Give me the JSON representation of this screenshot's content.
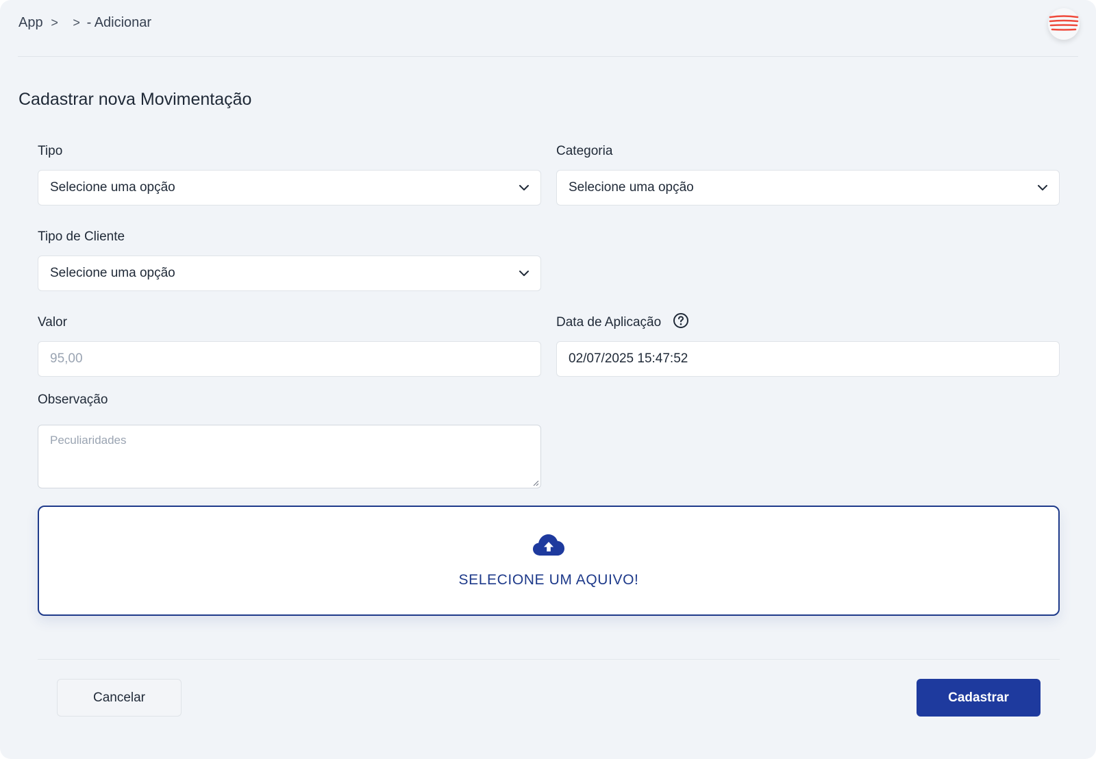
{
  "breadcrumb": {
    "root": "App",
    "separator": ">",
    "current": "- Adicionar"
  },
  "header": {
    "menu_icon": "hamburger-menu-icon",
    "menu_icon_color": "#ef4a3c"
  },
  "page": {
    "title": "Cadastrar nova Movimentação"
  },
  "form": {
    "tipo": {
      "label": "Tipo",
      "value": "Selecione uma opção"
    },
    "categoria": {
      "label": "Categoria",
      "value": "Selecione uma opção"
    },
    "tipo_cliente": {
      "label": "Tipo de Cliente",
      "value": "Selecione uma opção"
    },
    "valor": {
      "label": "Valor",
      "placeholder": "95,00"
    },
    "data_aplicacao": {
      "label": "Data de Aplicação",
      "value": "02/07/2025 15:47:52",
      "help_icon": "question-circle-icon"
    },
    "observacao": {
      "label": "Observação",
      "placeholder": "Peculiaridades"
    }
  },
  "upload": {
    "icon": "cloud-upload-icon",
    "label": "SELECIONE UM AQUIVO!"
  },
  "actions": {
    "cancel_label": "Cancelar",
    "submit_label": "Cadastrar"
  },
  "colors": {
    "primary": "#1e3a9e",
    "background": "#f1f4f8",
    "accent": "#ef4a3c"
  }
}
